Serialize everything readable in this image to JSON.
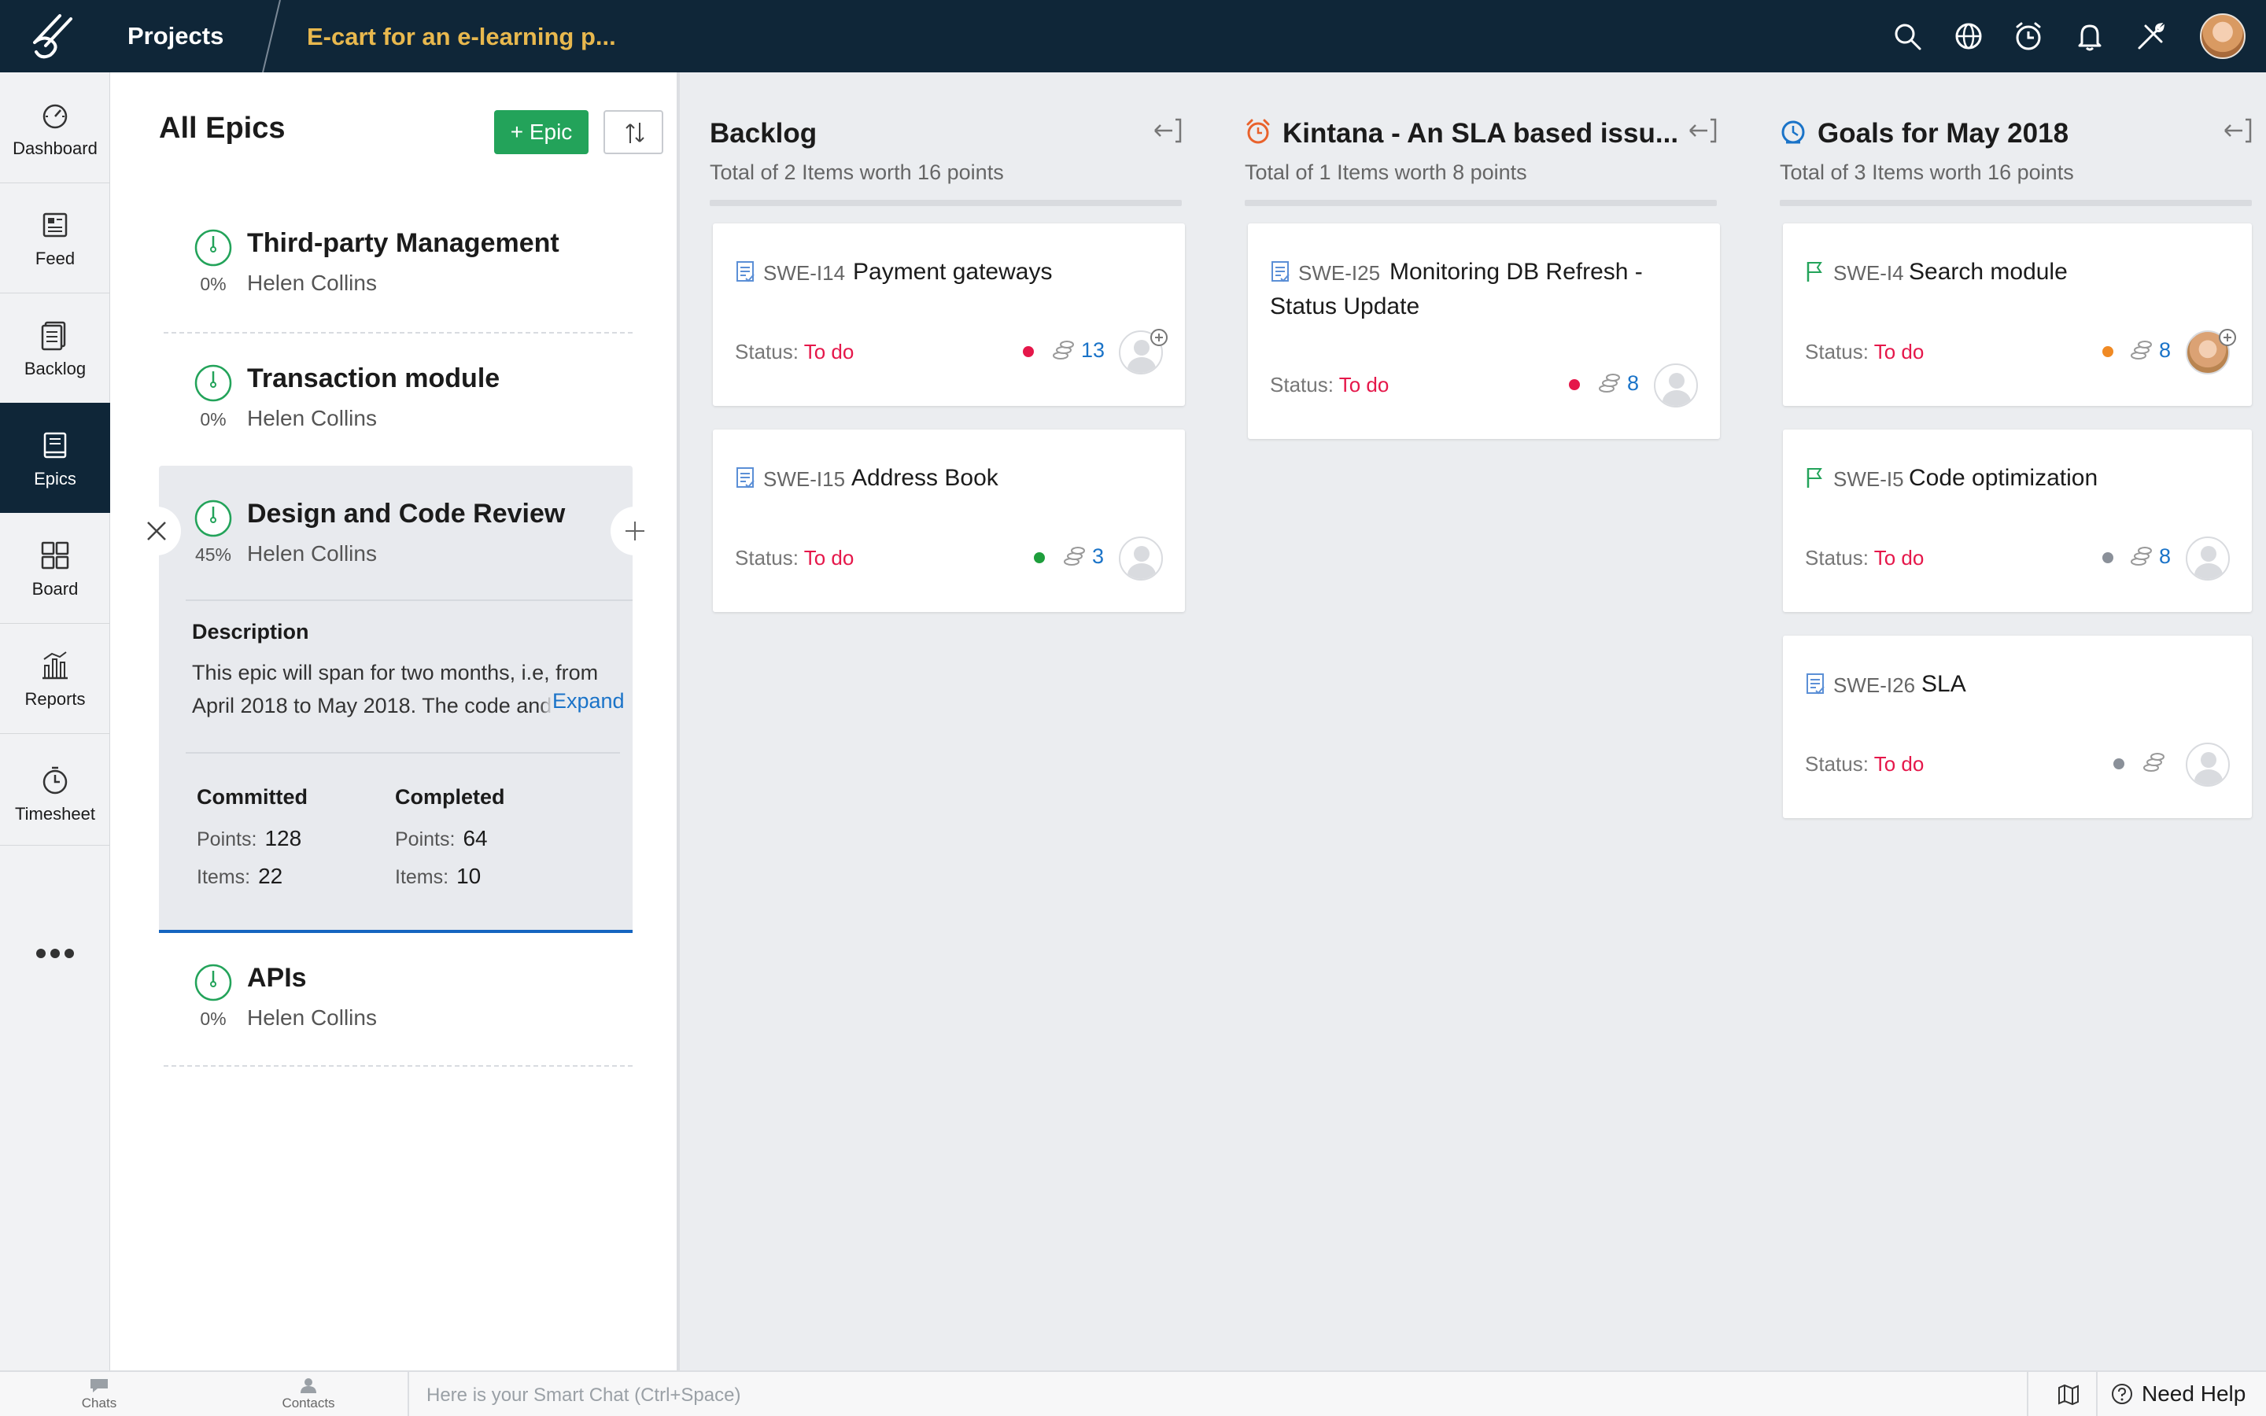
{
  "header": {
    "nav_title": "Projects",
    "project_name": "E-cart for an e-learning p...",
    "icons": [
      "search-icon",
      "globe-icon",
      "timer-icon",
      "bell-icon",
      "tools-icon",
      "user-avatar"
    ]
  },
  "rail": {
    "items": [
      {
        "label": "Dashboard",
        "icon": "dashboard-icon",
        "active": false
      },
      {
        "label": "Feed",
        "icon": "feed-icon",
        "active": false
      },
      {
        "label": "Backlog",
        "icon": "backlog-icon",
        "active": false
      },
      {
        "label": "Epics",
        "icon": "epics-icon",
        "active": true
      },
      {
        "label": "Board",
        "icon": "board-icon",
        "active": false
      },
      {
        "label": "Reports",
        "icon": "reports-icon",
        "active": false
      },
      {
        "label": "Timesheet",
        "icon": "timesheet-icon",
        "active": false
      }
    ],
    "more_icon": "more-icon"
  },
  "epics": {
    "title": "All Epics",
    "add_button": "+ Epic",
    "items": [
      {
        "name": "Third-party Management",
        "progress": "0%",
        "owner": "Helen Collins"
      },
      {
        "name": "Transaction module",
        "progress": "0%",
        "owner": "Helen Collins"
      },
      {
        "name": "Design and Code Review",
        "progress": "45%",
        "owner": "Helen Collins"
      },
      {
        "name": "APIs",
        "progress": "0%",
        "owner": "Helen Collins"
      }
    ],
    "selected": {
      "description_label": "Description",
      "description": "This epic will span for two months, i.e, from April 2018 to May 2018. The code and design",
      "expand": "Expand",
      "committed_label": "Committed",
      "completed_label": "Completed",
      "points_label": "Points:",
      "items_label": "Items:",
      "committed_points": "128",
      "committed_items": "22",
      "completed_points": "64",
      "completed_items": "10"
    }
  },
  "columns": [
    {
      "title": "Backlog",
      "summary": "Total of 2 Items worth 16 points",
      "cards": [
        {
          "id": "SWE-I14",
          "title": "Payment gateways",
          "status_label": "Status:",
          "status": "To do",
          "points": "13",
          "dot_color": "#e5174a"
        },
        {
          "id": "SWE-I15",
          "title": "Address Book",
          "status_label": "Status:",
          "status": "To do",
          "points": "3",
          "dot_color": "#1e9e3c"
        }
      ]
    },
    {
      "title": "Kintana - An SLA based issu...",
      "summary": "Total of 1 Items worth 8 points",
      "cards": [
        {
          "id": "SWE-I25",
          "title_line1": "Monitoring DB Refresh -",
          "title_line2": "Status Update",
          "status_label": "Status:",
          "status": "To do",
          "points": "8",
          "dot_color": "#e5174a"
        }
      ]
    },
    {
      "title": "Goals for May 2018",
      "summary": "Total of 3 Items worth 16 points",
      "cards": [
        {
          "id": "SWE-I4",
          "title": "Search module",
          "status_label": "Status:",
          "status": "To do",
          "points": "8",
          "dot_color": "#f08a24"
        },
        {
          "id": "SWE-I5",
          "title": "Code optimization",
          "status_label": "Status:",
          "status": "To do",
          "points": "8",
          "dot_color": "#8a9099"
        },
        {
          "id": "SWE-I26",
          "title": "SLA",
          "status_label": "Status:",
          "status": "To do",
          "points": "",
          "dot_color": "#8a9099"
        }
      ]
    }
  ],
  "bottombar": {
    "chats": "Chats",
    "contacts": "Contacts",
    "chat_placeholder": "Here is your Smart Chat (Ctrl+Space)",
    "help": "Need Help"
  },
  "colors": {
    "topbar": "#0f2638",
    "accent_green": "#23a35a",
    "status_red": "#e5174a",
    "link_blue": "#1a73c8",
    "project_name": "#e8b84e"
  }
}
